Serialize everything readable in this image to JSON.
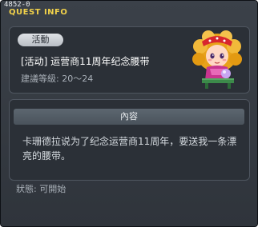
{
  "window": {
    "quest_id": "4852-0",
    "title": "QUEST INFO"
  },
  "quest": {
    "badge": "活動",
    "name": "[活动] 运营商11周年纪念腰带",
    "level_label": "建議等級:",
    "level_range": "20～24"
  },
  "content": {
    "header": "內容",
    "description": "卡珊德拉说为了纪念运营商11周年，要送我一条漂亮的腰带。"
  },
  "status": {
    "label": "狀態:",
    "value": "可開始"
  },
  "colors": {
    "title": "#f2d24a",
    "background": "#353a41",
    "badge": "#d3d7dc"
  },
  "icons": {
    "npc": "npc-portrait"
  }
}
